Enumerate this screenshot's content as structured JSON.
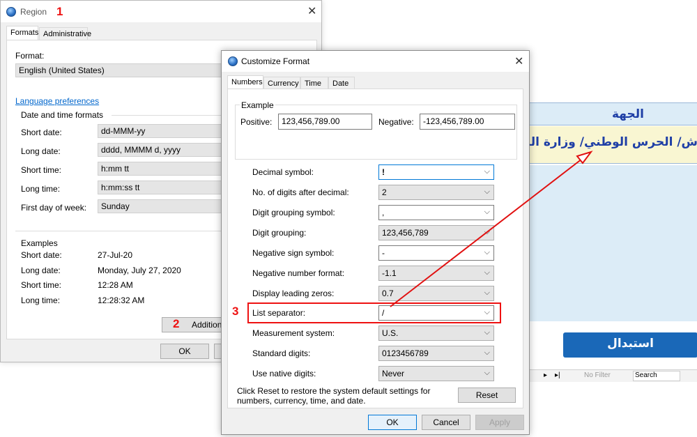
{
  "annotations": {
    "one": "1",
    "two": "2",
    "three": "3"
  },
  "region": {
    "title": "Region",
    "tabs": [
      "Formats",
      "Administrative"
    ],
    "format_label": "Format:",
    "format_value": "English (United States)",
    "language_link": "Language preferences",
    "datetime_header": "Date and time formats",
    "rows": [
      {
        "label": "Short date:",
        "value": "dd-MMM-yy"
      },
      {
        "label": "Long date:",
        "value": "dddd, MMMM d, yyyy"
      },
      {
        "label": "Short time:",
        "value": "h:mm tt"
      },
      {
        "label": "Long time:",
        "value": "h:mm:ss tt"
      },
      {
        "label": "First day of week:",
        "value": "Sunday"
      }
    ],
    "examples_header": "Examples",
    "examples": [
      {
        "label": "Short date:",
        "value": "27-Jul-20"
      },
      {
        "label": "Long date:",
        "value": "Monday, July 27, 2020"
      },
      {
        "label": "Short time:",
        "value": "12:28 AM"
      },
      {
        "label": "Long time:",
        "value": "12:28:32 AM"
      }
    ],
    "additional_button": "Addition",
    "ok_button": "OK"
  },
  "bg_form": {
    "heading": "الجهة",
    "value": "ش/ الحرس الوطني/ وزارة الداخ",
    "replace_button": "استبدال",
    "nav_next": "▸",
    "nav_last": "▸|",
    "no_filter": "No Filter",
    "search": "Search"
  },
  "customize": {
    "title": "Customize Format",
    "tabs": [
      "Numbers",
      "Currency",
      "Time",
      "Date"
    ],
    "example_label": "Example",
    "positive_label": "Positive:",
    "positive_value": "123,456,789.00",
    "negative_label": "Negative:",
    "negative_value": "-123,456,789.00",
    "rows": [
      {
        "label": "Decimal symbol:",
        "value": "!"
      },
      {
        "label": "No. of digits after decimal:",
        "value": "2"
      },
      {
        "label": "Digit grouping symbol:",
        "value": ","
      },
      {
        "label": "Digit grouping:",
        "value": "123,456,789"
      },
      {
        "label": "Negative sign symbol:",
        "value": "-"
      },
      {
        "label": "Negative number format:",
        "value": "-1.1"
      },
      {
        "label": "Display leading zeros:",
        "value": "0.7"
      },
      {
        "label": "List separator:",
        "value": "/"
      },
      {
        "label": "Measurement system:",
        "value": "U.S."
      },
      {
        "label": "Standard digits:",
        "value": "0123456789"
      },
      {
        "label": "Use native digits:",
        "value": "Never"
      }
    ],
    "reset_text": "Click Reset to restore the system default settings for numbers, currency, time, and date.",
    "reset_button": "Reset",
    "ok_button": "OK",
    "cancel_button": "Cancel",
    "apply_button": "Apply"
  },
  "colors": {
    "annotation_red": "#e11111",
    "accent_blue": "#0078d7",
    "form_header_bg": "#dcecf7",
    "form_value_bg": "#f9f6d2",
    "replace_button_bg": "#1a68b8"
  }
}
